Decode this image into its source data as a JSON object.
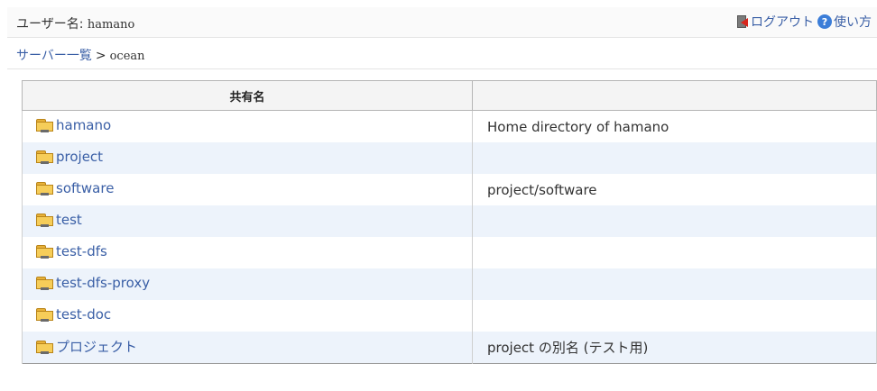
{
  "header": {
    "user_label": "ユーザー名: ",
    "user_name": "hamano",
    "logout_label": "ログアウト",
    "help_label": "使い方",
    "help_icon_glyph": "?"
  },
  "breadcrumb": {
    "root_label": "サーバー一覧",
    "separator": ">",
    "current": "ocean"
  },
  "table": {
    "headers": [
      "共有名",
      ""
    ],
    "rows": [
      {
        "name": "hamano",
        "description": "Home directory of hamano"
      },
      {
        "name": "project",
        "description": ""
      },
      {
        "name": "software",
        "description": "project/software"
      },
      {
        "name": "test",
        "description": ""
      },
      {
        "name": "test-dfs",
        "description": ""
      },
      {
        "name": "test-dfs-proxy",
        "description": ""
      },
      {
        "name": "test-doc",
        "description": ""
      },
      {
        "name": "プロジェクト",
        "description": "project の別名 (テスト用)"
      }
    ]
  },
  "colors": {
    "link": "#3a5fa6",
    "row_alt": "#edf3fb",
    "folder": "#f6cd59",
    "logout_arrow": "#d9261c",
    "help_icon": "#3b7dd8"
  },
  "icons": {
    "logout": "logout-icon",
    "help": "help-icon",
    "folder": "shared-folder-icon"
  }
}
